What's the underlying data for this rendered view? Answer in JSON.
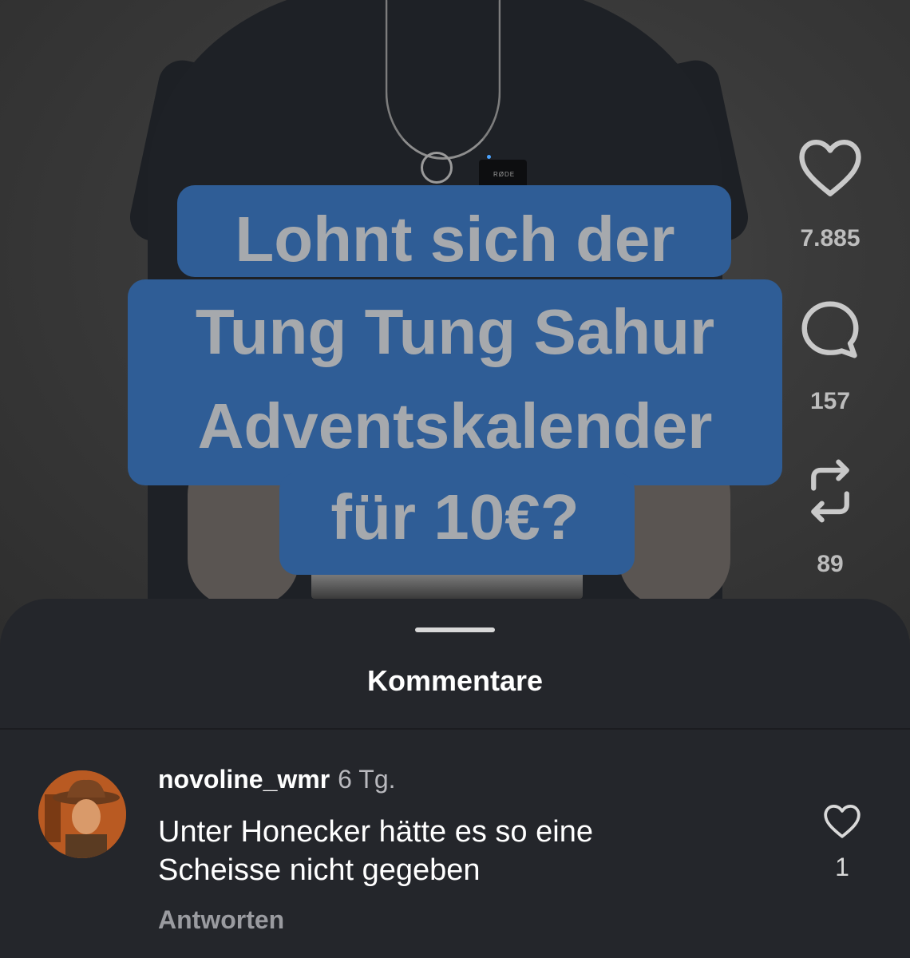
{
  "video": {
    "caption_lines": [
      "Lohnt sich der",
      "Tung Tung Sahur",
      "Adventskalender",
      "für 10€?"
    ],
    "mic_label": "RØDE"
  },
  "actions": {
    "likes": "7.885",
    "comments": "157",
    "reposts": "89"
  },
  "sheet": {
    "title": "Kommentare"
  },
  "comment": {
    "username": "novoline_wmr",
    "time": "6 Tg.",
    "text_line1": "Unter Honecker hätte es so eine",
    "text_line2": "Scheisse nicht gegeben",
    "reply": "Antworten",
    "like_count": "1"
  },
  "colors": {
    "caption_bg": "#2f5d96",
    "caption_text": "#a6a9ad",
    "sheet_bg": "#24262b"
  },
  "icons": [
    "heart-icon",
    "comment-bubble-icon",
    "repost-icon",
    "comment-heart-icon"
  ]
}
